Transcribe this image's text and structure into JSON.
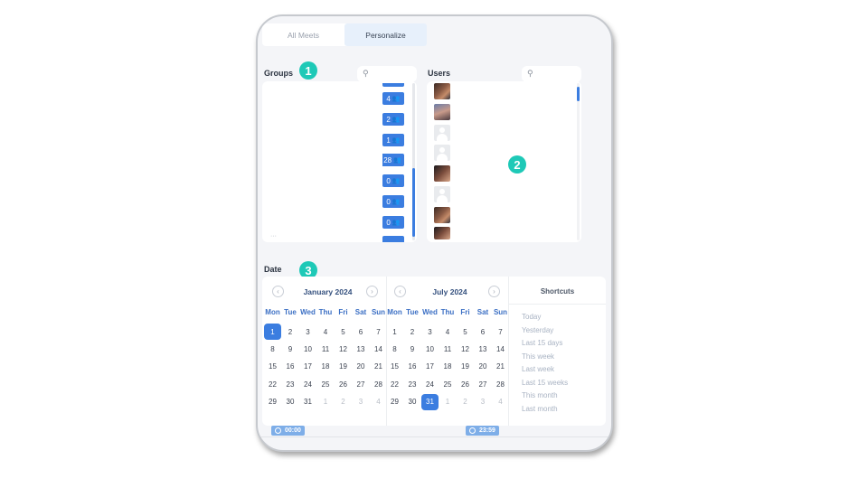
{
  "tabs": [
    {
      "label": "All Meets",
      "active": false
    },
    {
      "label": "Personalize",
      "active": true
    }
  ],
  "groups": {
    "title": "Groups",
    "step": "1",
    "cut_label": "···",
    "counts": [
      "4",
      "2",
      "1",
      "28",
      "0",
      "0",
      "0"
    ],
    "count_icon": "people-icon"
  },
  "users": {
    "title": "Users",
    "step": "2",
    "avatars": [
      "photo",
      "photo2",
      "blank",
      "blank",
      "photo3",
      "blank",
      "photo",
      "photo3"
    ]
  },
  "date": {
    "title": "Date",
    "step": "3",
    "weekdays": [
      "Mon",
      "Tue",
      "Wed",
      "Thu",
      "Fri",
      "Sat",
      "Sun"
    ],
    "months": [
      {
        "title": "January 2024",
        "weeks": [
          [
            "1",
            "2",
            "3",
            "4",
            "5",
            "6",
            "7"
          ],
          [
            "8",
            "9",
            "10",
            "11",
            "12",
            "13",
            "14"
          ],
          [
            "15",
            "16",
            "17",
            "18",
            "19",
            "20",
            "21"
          ],
          [
            "22",
            "23",
            "24",
            "25",
            "26",
            "27",
            "28"
          ],
          [
            "29",
            "30",
            "31",
            "1",
            "2",
            "3",
            "4"
          ]
        ],
        "muted_from_last_week": 3,
        "selected": "1",
        "time": "00:00"
      },
      {
        "title": "July 2024",
        "weeks": [
          [
            "1",
            "2",
            "3",
            "4",
            "5",
            "6",
            "7"
          ],
          [
            "8",
            "9",
            "10",
            "11",
            "12",
            "13",
            "14"
          ],
          [
            "15",
            "16",
            "17",
            "18",
            "19",
            "20",
            "21"
          ],
          [
            "22",
            "23",
            "24",
            "25",
            "26",
            "27",
            "28"
          ],
          [
            "29",
            "30",
            "31",
            "1",
            "2",
            "3",
            "4"
          ]
        ],
        "muted_from_last_week": 3,
        "selected": "31",
        "time": "23:59"
      }
    ],
    "shortcuts_title": "Shortcuts",
    "shortcuts": [
      "Today",
      "Yesterday",
      "Last 15 days",
      "This week",
      "Last week",
      "Last 15 weeks",
      "This month",
      "Last month"
    ]
  },
  "colors": {
    "accent": "#3b7de0",
    "step_badge": "#1ec9b7",
    "weekday": "#3b6fc4"
  }
}
